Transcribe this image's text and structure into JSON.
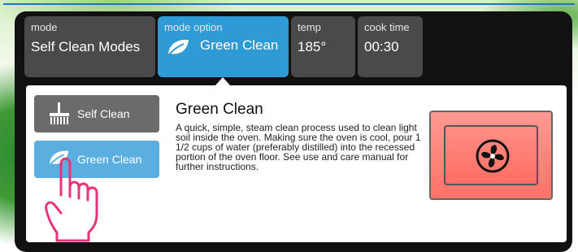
{
  "tabs": {
    "mode": {
      "label": "mode",
      "value": "Self Clean Modes"
    },
    "mode_option": {
      "label": "mode option",
      "value": "Green Clean"
    },
    "temp": {
      "label": "temp",
      "value": "185°"
    },
    "cook_time": {
      "label": "cook time",
      "value": "00:30"
    }
  },
  "options": [
    {
      "label": "Self Clean",
      "icon": "broom-icon"
    },
    {
      "label": "Green Clean",
      "icon": "leaf-icon"
    }
  ],
  "detail": {
    "title": "Green Clean",
    "description": "A quick, simple, steam clean process used to clean light soil inside the oven. Making sure the oven is cool, pour 1 1/2 cups of water (preferably distilled) into the recessed portion of the oven floor. See use and care manual for further instructions."
  },
  "start_button": {
    "icon": "fan-icon"
  },
  "colors": {
    "tab_selected": "#2e9ad6",
    "option_selected": "#5aaee0",
    "start": "#ff7268"
  }
}
